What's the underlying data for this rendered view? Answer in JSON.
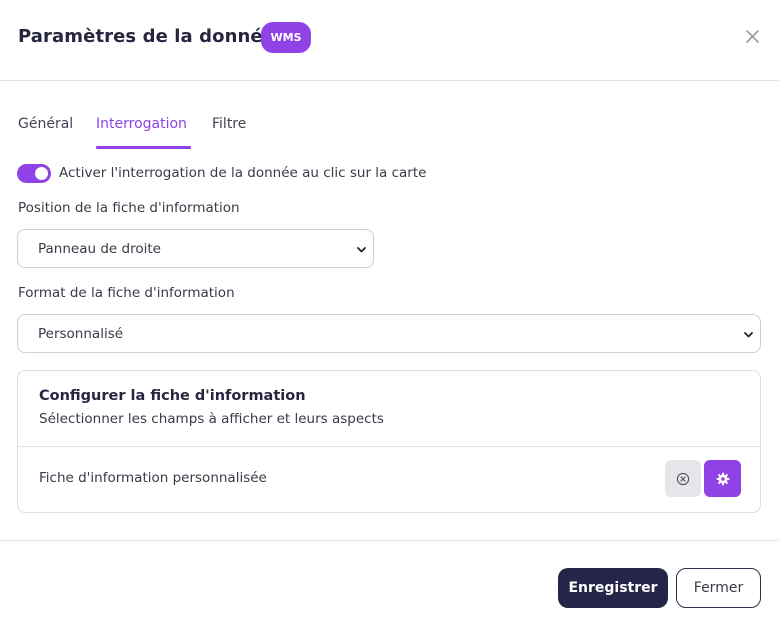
{
  "header": {
    "title": "Paramètres de la donnée",
    "badge": "WMS",
    "close_icon": "close-icon"
  },
  "tabs": [
    {
      "label": "Général",
      "active": false
    },
    {
      "label": "Interrogation",
      "active": true
    },
    {
      "label": "Filtre",
      "active": false
    }
  ],
  "toggle": {
    "label": "Activer l'interrogation de la donnée au clic sur la carte",
    "checked": true
  },
  "position": {
    "label": "Position de la fiche d'information",
    "value": "Panneau de droite"
  },
  "format": {
    "label": "Format de la fiche d'information",
    "value": "Personnalisé"
  },
  "card": {
    "title": "Configurer la fiche d'information",
    "subtitle": "Sélectionner les champs à afficher et leurs aspects",
    "row_label": "Fiche d'information personnalisée",
    "clear_icon": "clear-circle-icon",
    "settings_icon": "gear-icon"
  },
  "footer": {
    "save_label": "Enregistrer",
    "close_label": "Fermer"
  },
  "colors": {
    "accent": "#8f42e6",
    "primary_dark": "#25254a"
  }
}
